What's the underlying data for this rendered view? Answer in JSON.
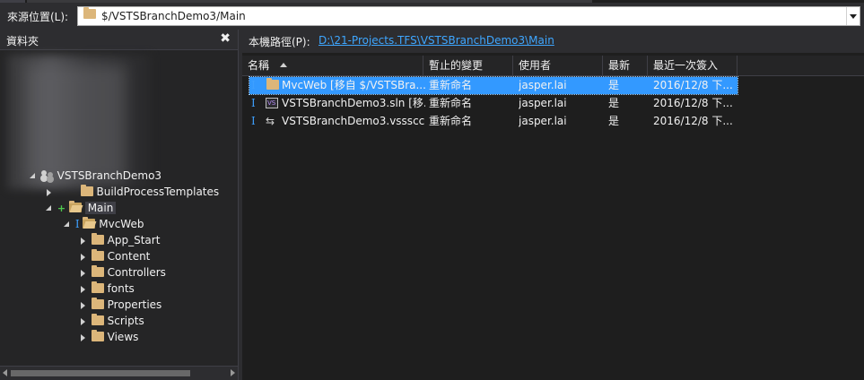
{
  "source_bar": {
    "label": "來源位置(L):",
    "value": "$/VSTSBranchDemo3/Main"
  },
  "folders_panel": {
    "title": "資料夾",
    "close_glyph": "✖",
    "tree": [
      {
        "label": "VSTSBranchDemo3"
      },
      {
        "label": "BuildProcessTemplates"
      },
      {
        "label": "Main",
        "badge": "+"
      },
      {
        "label": "MvcWeb",
        "badge": "I"
      },
      {
        "label": "App_Start"
      },
      {
        "label": "Content"
      },
      {
        "label": "Controllers"
      },
      {
        "label": "fonts"
      },
      {
        "label": "Properties"
      },
      {
        "label": "Scripts"
      },
      {
        "label": "Views"
      }
    ]
  },
  "local_path": {
    "label": "本機路徑(P):",
    "value": "D:\\21-Projects.TFS\\VSTSBranchDemo3\\Main"
  },
  "file_list": {
    "columns": [
      "名稱",
      "暫止的變更",
      "使用者",
      "最新",
      "最近一次簽入"
    ],
    "rows": [
      {
        "badge": "I",
        "name": "MvcWeb [移自 $/VSTSBra...",
        "change": "重新命名",
        "user": "jasper.lai",
        "latest": "是",
        "checkin": "2016/12/8 下..."
      },
      {
        "badge": "I",
        "name": "VSTSBranchDemo3.sln [移...",
        "change": "重新命名",
        "user": "jasper.lai",
        "latest": "是",
        "checkin": "2016/12/8 下..."
      },
      {
        "badge": "I",
        "name": "VSTSBranchDemo3.vssscc ...",
        "change": "重新命名",
        "user": "jasper.lai",
        "latest": "是",
        "checkin": "2016/12/8 下..."
      }
    ]
  },
  "colors": {
    "background": "#2d2d30",
    "selection": "#3399ff",
    "link": "#3ea6ff",
    "pending_badge": "#3ea0ff",
    "add_badge": "#4ec94e",
    "folder": "#dcb67a"
  },
  "icons": [
    "folder-icon",
    "team-project-icon",
    "solution-file-icon",
    "source-control-file-icon",
    "close-icon",
    "dropdown-arrow-icon",
    "sort-ascending-icon"
  ]
}
